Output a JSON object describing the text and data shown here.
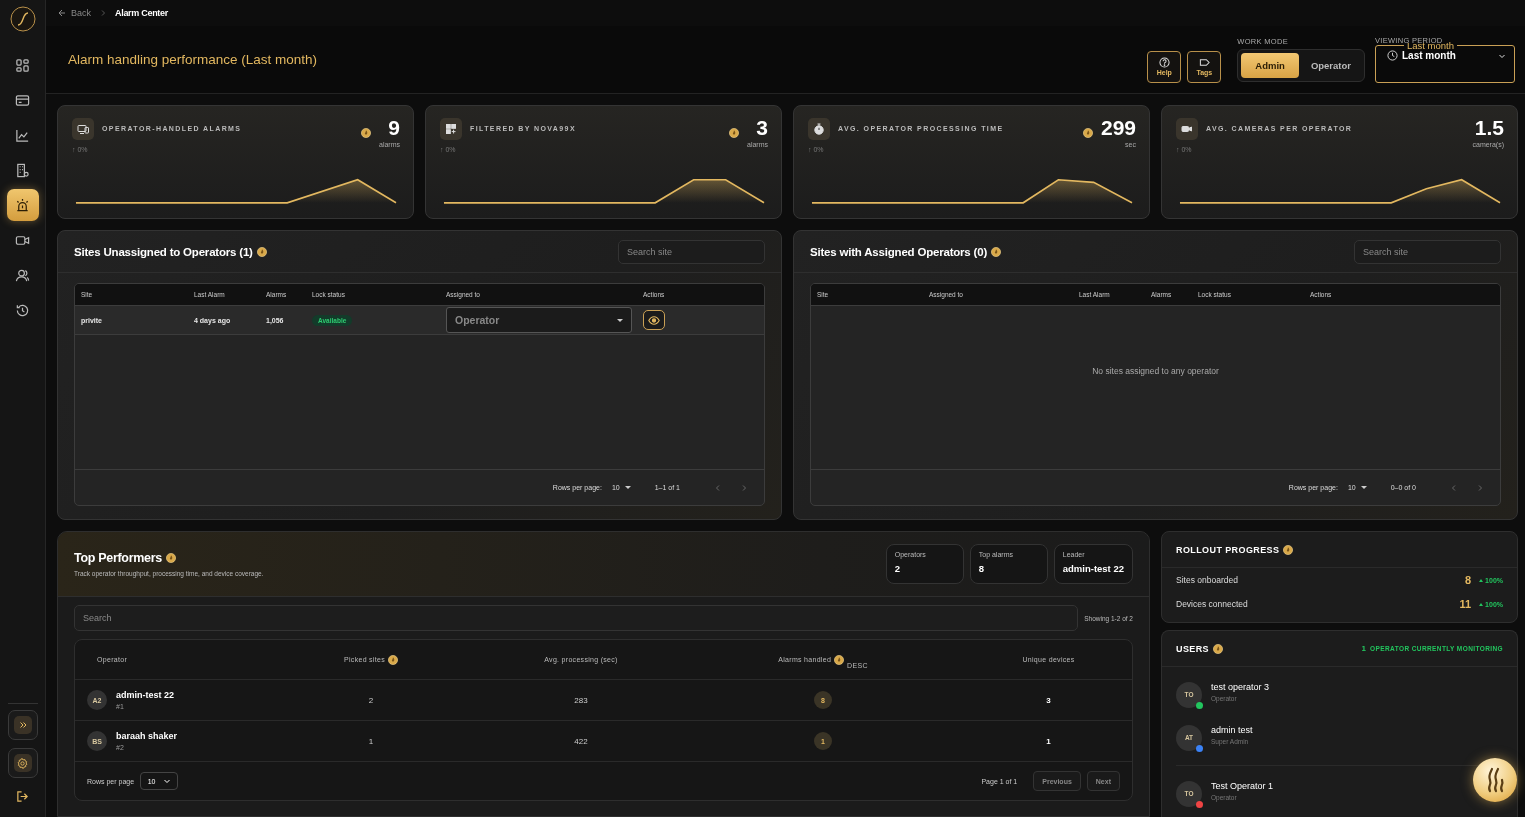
{
  "sidebar": {
    "items": [
      {
        "selected": false
      },
      {
        "selected": false
      },
      {
        "selected": false
      },
      {
        "selected": false
      },
      {
        "selected": true
      },
      {
        "selected": false
      },
      {
        "selected": false
      },
      {
        "selected": false
      }
    ]
  },
  "breadcrumb": {
    "back": "Back",
    "current": "Alarm Center"
  },
  "header": {
    "title": "Alarm handling performance (Last month)",
    "help": "Help",
    "tags": "Tags",
    "work_mode": {
      "label": "WORK MODE",
      "options": [
        {
          "label": "Admin",
          "selected": true
        },
        {
          "label": "Operator",
          "selected": false
        }
      ]
    },
    "viewing_period": {
      "label": "VIEWING PERIOD",
      "legend": "Last month",
      "value": "Last month"
    }
  },
  "kpis": [
    {
      "title": "OPERATOR-HANDLED ALARMS",
      "value": "9",
      "unit": "alarms",
      "change": "↑ 0%",
      "info": true
    },
    {
      "title": "FILTERED BY NOVA99X",
      "value": "3",
      "unit": "alarms",
      "change": "↑ 0%",
      "info": true
    },
    {
      "title": "AVG. OPERATOR PROCESSING TIME",
      "value": "299",
      "unit": "sec",
      "change": "↑ 0%",
      "info": true
    },
    {
      "title": "AVG. CAMERAS PER OPERATOR",
      "value": "1.5",
      "unit": "camera(s)",
      "change": "↑ 0%",
      "info": false
    }
  ],
  "site_panels": [
    {
      "title": "Sites Unassigned to Operators (1)",
      "search_placeholder": "Search site",
      "columns": [
        "Site",
        "Last Alarm",
        "Alarms",
        "Lock status",
        "Assigned to",
        "Actions"
      ],
      "rows": [
        {
          "site": "privite",
          "last_alarm": "4 days ago",
          "alarms": "1,056",
          "lock_status": "Available",
          "assign_placeholder": "Operator"
        }
      ],
      "rows_per_page_label": "Rows per page:",
      "rows_per_page": "10",
      "range": "1–1 of 1"
    },
    {
      "title": "Sites with Assigned Operators (0)",
      "search_placeholder": "Search site",
      "columns": [
        "Site",
        "Assigned to",
        "Last Alarm",
        "Alarms",
        "Lock status",
        "Actions"
      ],
      "empty": "No sites assigned to any operator",
      "rows_per_page_label": "Rows per page:",
      "rows_per_page": "10",
      "range": "0–0 of 0"
    }
  ],
  "top_performers": {
    "title": "Top Performers",
    "subtitle": "Track operator throughput, processing time, and device coverage.",
    "stats": [
      {
        "label": "Operators",
        "value": "2"
      },
      {
        "label": "Top alarms",
        "value": "8"
      },
      {
        "label": "Leader",
        "value": "admin-test 22"
      }
    ],
    "search_placeholder": "Search",
    "showing": "Showing 1-2 of 2",
    "columns": [
      {
        "label": "Operator",
        "info": false
      },
      {
        "label": "Picked sites",
        "info": true
      },
      {
        "label": "Avg. processing (sec)",
        "info": false
      },
      {
        "label": "Alarms handled",
        "info": true,
        "sort": "DESC"
      },
      {
        "label": "Unique devices",
        "info": false
      }
    ],
    "rows": [
      {
        "initials": "A2",
        "name": "admin-test 22",
        "rank": "#1",
        "picked": "2",
        "avg": "283",
        "alarms": "8",
        "devices": "3"
      },
      {
        "initials": "BS",
        "name": "baraah shaker",
        "rank": "#2",
        "picked": "1",
        "avg": "422",
        "alarms": "1",
        "devices": "1"
      }
    ],
    "rows_per_page_label": "Rows per page",
    "rows_per_page": "10",
    "page": "Page 1 of 1",
    "pager": [
      {
        "label": "Previous",
        "disabled": true
      },
      {
        "label": "Next",
        "disabled": true
      }
    ]
  },
  "rollout": {
    "title": "ROLLOUT PROGRESS",
    "items": [
      {
        "label": "Sites onboarded",
        "value": "8",
        "change": "100%"
      },
      {
        "label": "Devices connected",
        "value": "11",
        "change": "100%"
      }
    ]
  },
  "users": {
    "title": "USERS",
    "monitoring_count": "1",
    "monitoring_label": "OPERATOR CURRENTLY MONITORING",
    "groups": [
      [
        {
          "initials": "TO",
          "name": "test operator 3",
          "role": "Operator",
          "color": "#22c55e"
        },
        {
          "initials": "AT",
          "name": "admin test",
          "role": "Super Admin",
          "color": "#3b82f6"
        }
      ],
      [
        {
          "initials": "TO",
          "name": "Test Operator 1",
          "role": "Operator",
          "color": "#ef4444"
        }
      ]
    ]
  }
}
